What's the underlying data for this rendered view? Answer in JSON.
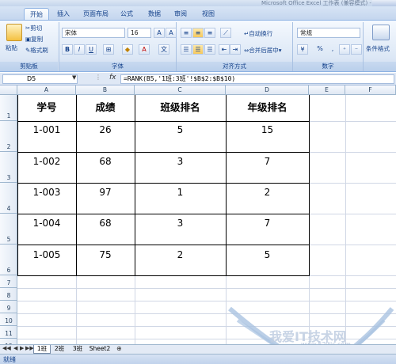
{
  "window": {
    "title": "Microsoft Office Excel 工作表 (兼容模式) - Micro"
  },
  "ribbon_tabs": [
    "开始",
    "插入",
    "页面布局",
    "公式",
    "数据",
    "审阅",
    "视图"
  ],
  "clipboard": {
    "paste_label": "粘贴",
    "cut_label": "剪切",
    "copy_label": "复制",
    "format_painter_label": "格式刷",
    "group_label": "剪贴板"
  },
  "font": {
    "name_value": "宋体",
    "size_value": "16",
    "group_label": "字体"
  },
  "alignment": {
    "wrap_label": "自动换行",
    "merge_label": "合并后居中",
    "group_label": "对齐方式"
  },
  "number": {
    "format_value": "常规",
    "percent_label": "%",
    "comma_label": ",",
    "group_label": "数字"
  },
  "styles": {
    "conditional_label": "条件格式"
  },
  "formula_bar": {
    "cell_ref": "D5",
    "fx_label": "fx",
    "formula": "=RANK(B5,'1班:3班'!$B$2:$B$10)"
  },
  "columns": [
    "A",
    "B",
    "C",
    "D",
    "E",
    "F"
  ],
  "rows": [
    "1",
    "2",
    "3",
    "4",
    "5",
    "6",
    "7",
    "8",
    "9",
    "10",
    "11",
    "12"
  ],
  "table": {
    "headers": [
      "学号",
      "成绩",
      "班级排名",
      "年级排名"
    ],
    "rows": [
      [
        "1-001",
        "26",
        "5",
        "15"
      ],
      [
        "1-002",
        "68",
        "3",
        "7"
      ],
      [
        "1-003",
        "97",
        "1",
        "2"
      ],
      [
        "1-004",
        "68",
        "3",
        "7"
      ],
      [
        "1-005",
        "75",
        "2",
        "5"
      ]
    ]
  },
  "sheets": [
    "1班",
    "2班",
    "3班",
    "Sheet2"
  ],
  "active_sheet": "1班",
  "status": {
    "text": "就绪"
  },
  "watermark": {
    "text": "我爱IT技术网",
    "url": "www.52itjs.com"
  },
  "colors": {
    "ribbon_bg": "#dde8f6",
    "ribbon_text": "#15428b",
    "grid_line": "#d0d7e5",
    "table_border": "#000000"
  }
}
